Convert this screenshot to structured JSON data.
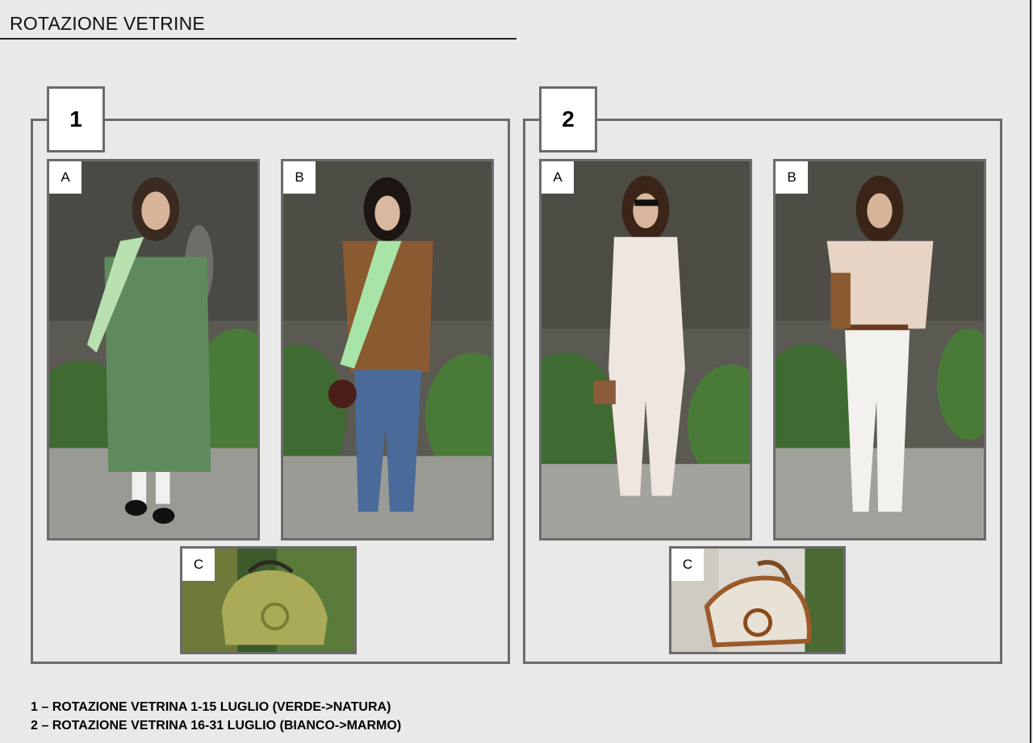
{
  "title": "ROTAZIONE VETRINE",
  "groups": [
    {
      "number": "1",
      "photos": [
        {
          "tag": "A",
          "subject": "green-look-runway"
        },
        {
          "tag": "B",
          "subject": "brown-jacket-look-runway"
        },
        {
          "tag": "C",
          "subject": "green-bag-detail"
        }
      ]
    },
    {
      "number": "2",
      "photos": [
        {
          "tag": "A",
          "subject": "white-lace-look-runway"
        },
        {
          "tag": "B",
          "subject": "white-fringe-look-runway"
        },
        {
          "tag": "C",
          "subject": "canvas-bag-detail"
        }
      ]
    }
  ],
  "legend": [
    "1 – ROTAZIONE VETRINA 1-15 LUGLIO (VERDE->NATURA)",
    "2 – ROTAZIONE VETRINA 16-31 LUGLIO (BIANCO->MARMO)"
  ]
}
